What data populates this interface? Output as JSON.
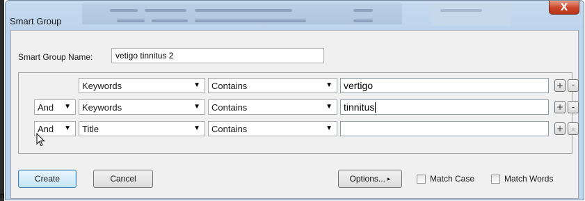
{
  "window": {
    "title": "Smart Group",
    "close_glyph": "X"
  },
  "form": {
    "name_label": "Smart Group Name:",
    "name_value": "vetigo tinnitus 2"
  },
  "criteria": [
    {
      "connector": "",
      "field": "Keywords",
      "operator": "Contains",
      "value": "vertigo"
    },
    {
      "connector": "And",
      "field": "Keywords",
      "operator": "Contains",
      "value": "tinnitus"
    },
    {
      "connector": "And",
      "field": "Title",
      "operator": "Contains",
      "value": ""
    }
  ],
  "row_buttons": {
    "add": "+",
    "remove": "-"
  },
  "buttons": {
    "create": "Create",
    "cancel": "Cancel",
    "options": "Options...",
    "options_arrow": "▸"
  },
  "checkboxes": {
    "match_case": "Match Case",
    "match_words": "Match Words"
  },
  "arrow_glyph": "▼",
  "outer_glyph": "n"
}
